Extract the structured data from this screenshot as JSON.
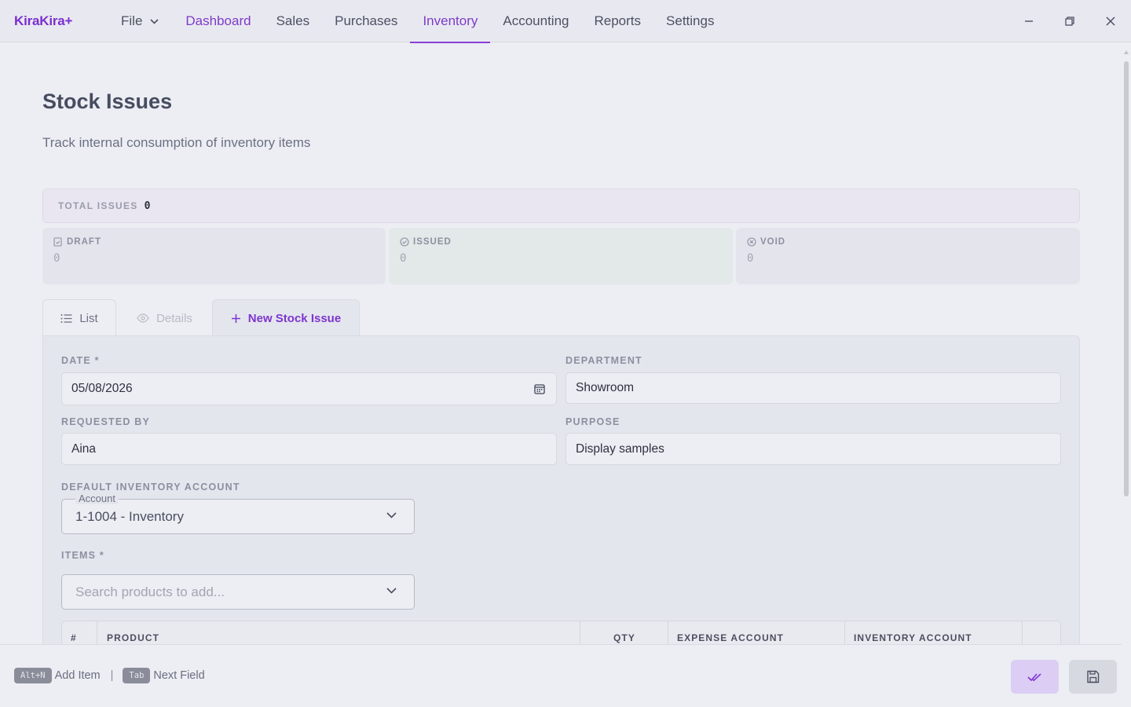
{
  "app": {
    "logo": "KiraKira+"
  },
  "menu": {
    "file": "File",
    "items": [
      "Dashboard",
      "Sales",
      "Purchases",
      "Inventory",
      "Accounting",
      "Reports",
      "Settings"
    ],
    "active": "Inventory"
  },
  "page": {
    "title": "Stock Issues",
    "subtitle": "Track internal consumption of inventory items"
  },
  "summary": {
    "total_label": "TOTAL ISSUES",
    "total_value": "0",
    "stats": [
      {
        "label": "DRAFT",
        "value": "0",
        "icon": "draft-icon"
      },
      {
        "label": "ISSUED",
        "value": "0",
        "icon": "check-circle-icon"
      },
      {
        "label": "VOID",
        "value": "0",
        "icon": "x-circle-icon"
      }
    ]
  },
  "tabs": {
    "list": "List",
    "details": "Details",
    "new": "New Stock Issue"
  },
  "form": {
    "date_label": "DATE *",
    "date_value": "05/08/2026",
    "department_label": "DEPARTMENT",
    "department_value": "Showroom",
    "requested_label": "REQUESTED BY",
    "requested_value": "Aina",
    "purpose_label": "PURPOSE",
    "purpose_value": "Display samples",
    "default_account_label": "DEFAULT INVENTORY ACCOUNT",
    "account_legend": "Account",
    "account_value": "1-1004 - Inventory",
    "items_label": "ITEMS *",
    "items_placeholder": "Search products to add..."
  },
  "table": {
    "headers": [
      "#",
      "PRODUCT",
      "QTY",
      "EXPENSE ACCOUNT",
      "INVENTORY ACCOUNT"
    ]
  },
  "footer": {
    "hint1_key": "Alt+N",
    "hint1_text": "Add Item",
    "separator": "|",
    "hint2_key": "Tab",
    "hint2_text": "Next Field"
  },
  "colors": {
    "accent": "#7e35cf",
    "background": "#eceef3",
    "panel": "#e4e6ed"
  }
}
